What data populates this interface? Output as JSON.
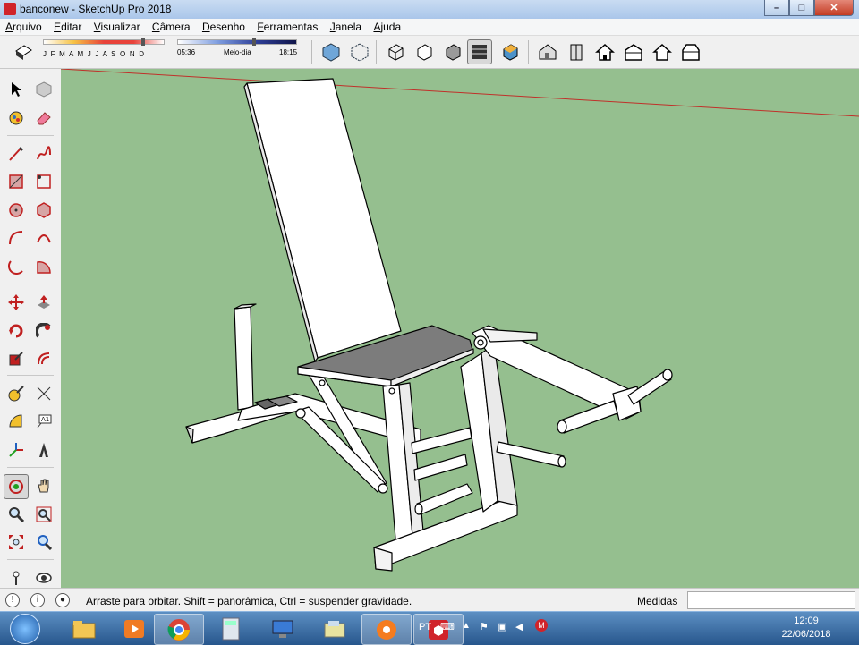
{
  "window": {
    "title": "banconew - SketchUp Pro 2018",
    "buttons": {
      "minimize": "–",
      "maximize": "□",
      "close": "✕"
    }
  },
  "menu": [
    "Arquivo",
    "Editar",
    "Visualizar",
    "Câmera",
    "Desenho",
    "Ferramentas",
    "Janela",
    "Ajuda"
  ],
  "toolbar": {
    "months": "J F M A M J J A S O N D",
    "time_start": "05:36",
    "time_mid": "Meio-dia",
    "time_end": "18:15",
    "active_style": "hidden-line-icon"
  },
  "statusbar": {
    "message": "Arraste para orbitar. Shift = panorâmica, Ctrl = suspender gravidade.",
    "measurements_label": "Medidas",
    "measurements_value": ""
  },
  "taskbar": {
    "language": "PT",
    "time": "12:09",
    "date": "22/06/2018",
    "apps": [
      "explorer-icon",
      "media-player-icon",
      "chrome-icon",
      "calculator-icon",
      "remote-desktop-icon",
      "folder-icon",
      "avast-icon",
      "sketchup-icon"
    ]
  },
  "colors": {
    "viewport_bg": "#95bf8f",
    "horizon_line": "#c0302a",
    "sketchup_red": "#d0232a"
  }
}
